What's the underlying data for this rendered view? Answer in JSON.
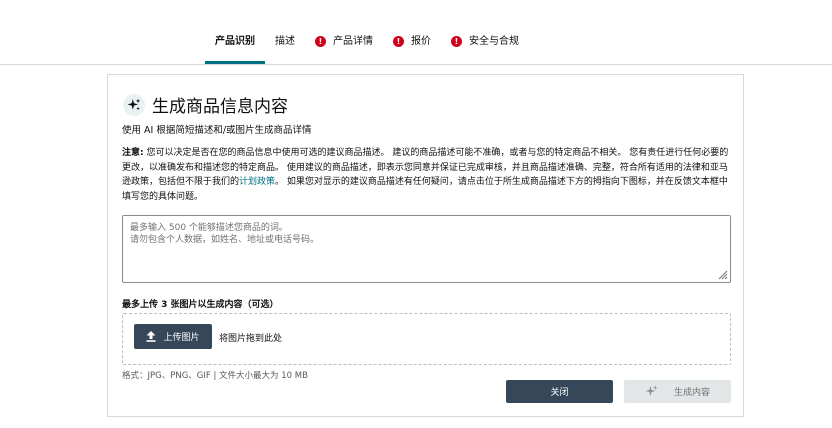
{
  "tabs": [
    {
      "label": "产品识别",
      "active": true,
      "warning": false
    },
    {
      "label": "描述",
      "active": false,
      "warning": false
    },
    {
      "label": "产品详情",
      "active": false,
      "warning": true
    },
    {
      "label": "报价",
      "active": false,
      "warning": true
    },
    {
      "label": "安全与合规",
      "active": false,
      "warning": true
    }
  ],
  "warning_glyph": "!",
  "colors": {
    "accent": "#007185",
    "warning": "#d0021b",
    "button_dark": "#37475a",
    "button_disabled": "#e3e6e6"
  },
  "card": {
    "title": "生成商品信息内容",
    "title_icon": "sparkle-icon",
    "subtitle": "使用 AI 根据简短描述和/或图片生成商品详情",
    "notice": {
      "label": "注意:",
      "text_1": " 您可以决定是否在您的商品信息中使用可选的建议商品描述。 建议的商品描述可能不准确，或者与您的特定商品不相关。 您有责任进行任何必要的更改，以准确发布和描述您的特定商品。 使用建议的商品描述，即表示您同意并保证已完成审核，并且商品描述准确、完整，符合所有适用的法律和亚马逊政策，包括但不限于我们的",
      "link": "计划政策",
      "text_2": "。 如果您对显示的建议商品描述有任何疑问，请点击位于所生成商品描述下方的拇指向下图标，并在反馈文本框中填写您的具体问题。"
    },
    "textarea": {
      "value": "",
      "placeholder": "最多输入 500 个能够描述您商品的词。\n请勿包含个人数据，如姓名、地址或电话号码。"
    },
    "upload": {
      "label": "最多上传 3 张图片以生成内容（可选）",
      "button": "上传图片",
      "button_icon": "upload-icon",
      "drop_hint": "将图片拖到此处",
      "format_hint": "格式：JPG、PNG、GIF | 文件大小最大为 10 MB"
    },
    "actions": {
      "close": "关闭",
      "generate": "生成内容",
      "generate_icon": "sparkle-icon"
    }
  }
}
